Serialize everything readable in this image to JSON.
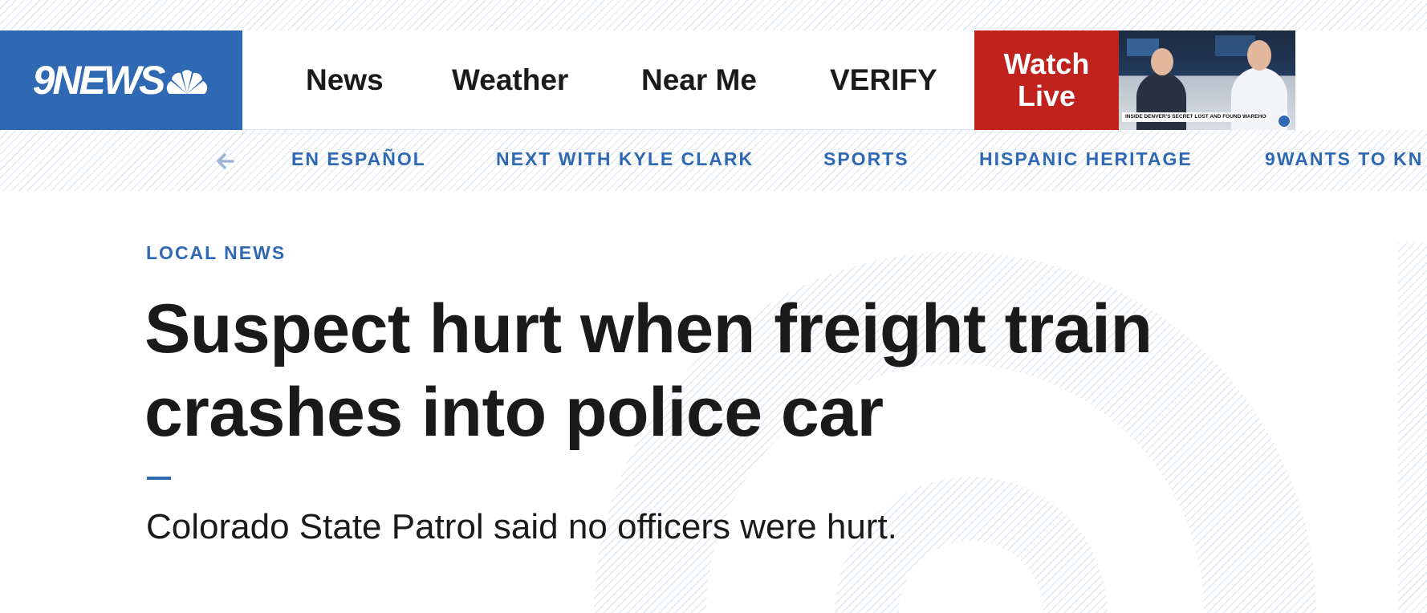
{
  "brand": {
    "logo_text": "9NEWS",
    "logo_icon": "nbc-peacock-icon",
    "accent_color": "#2f68b3",
    "live_color": "#c0231d"
  },
  "header": {
    "nav": [
      "News",
      "Weather",
      "Near Me",
      "VERIFY"
    ],
    "watch_live": {
      "line1": "Watch",
      "line2": "Live"
    },
    "live_thumbnail_caption": "INSIDE DENVER'S SECRET LOST AND FOUND WAREHOUSE"
  },
  "subnav": {
    "back_icon": "arrow-left-icon",
    "items": [
      "EN ESPAÑOL",
      "NEXT WITH KYLE CLARK",
      "SPORTS",
      "HISPANIC HERITAGE",
      "9WANTS TO KN"
    ]
  },
  "article": {
    "category": "LOCAL NEWS",
    "headline_line1": "Suspect hurt when freight train",
    "headline_line2": "crashes into police car",
    "subhead": "Colorado State Patrol said no officers were hurt."
  }
}
